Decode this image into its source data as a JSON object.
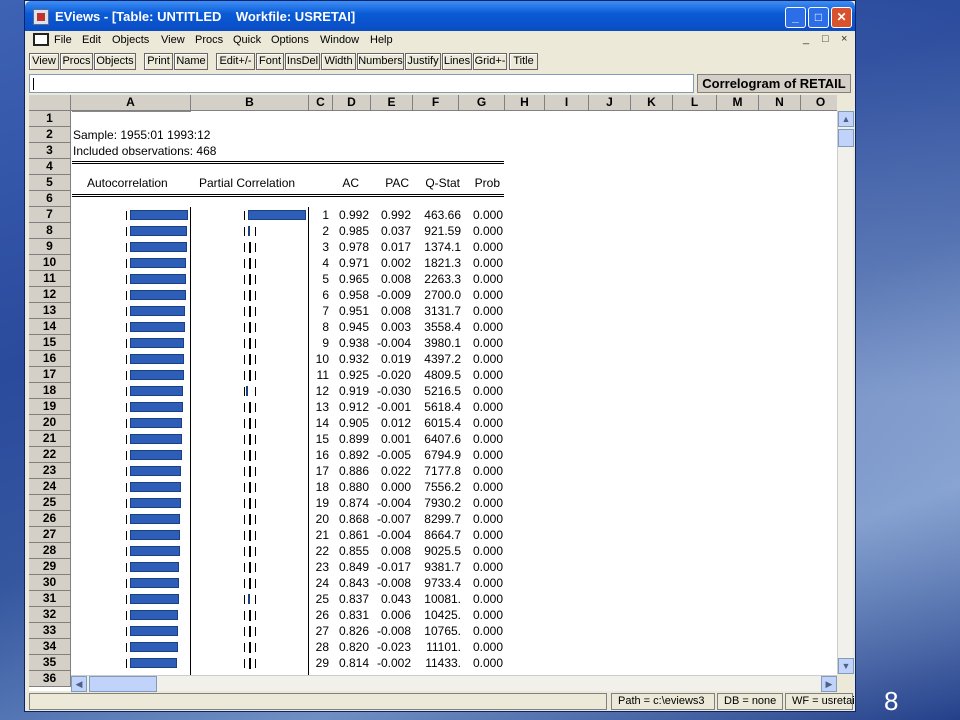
{
  "window": {
    "title": "EViews - [Table: UNTITLED    Workfile: USRETAI]"
  },
  "title_buttons": [
    "_",
    "□",
    "✕"
  ],
  "menu": [
    "File",
    "Edit",
    "Objects",
    "View",
    "Procs",
    "Quick",
    "Options",
    "Window",
    "Help"
  ],
  "mdi_controls": [
    "_",
    "□",
    "×"
  ],
  "toolbar": [
    "View",
    "Procs",
    "Objects",
    "Print",
    "Name",
    "Edit+/-",
    "Font",
    "InsDel",
    "Width",
    "Numbers",
    "Justify",
    "Lines",
    "Grid+-",
    "Title"
  ],
  "edit_field": {
    "value": ""
  },
  "table_title": "Correlogram of RETAIL",
  "columns": [
    "A",
    "B",
    "C",
    "D",
    "E",
    "F",
    "G",
    "H",
    "I",
    "J",
    "K",
    "L",
    "M",
    "N",
    "O"
  ],
  "row_numbers": [
    "1",
    "2",
    "3",
    "4",
    "5",
    "6",
    "7",
    "8",
    "9",
    "10",
    "11",
    "12",
    "13",
    "14",
    "15",
    "16",
    "17",
    "18",
    "19",
    "20",
    "21",
    "22",
    "23",
    "24",
    "25",
    "26",
    "27",
    "28",
    "29",
    "30",
    "31",
    "32",
    "33",
    "34",
    "35",
    "36"
  ],
  "header": {
    "sample": "Sample: 1955:01 1993:12",
    "included": "Included observations: 468"
  },
  "table_headers": {
    "autocorr": "Autocorrelation",
    "partial": "Partial Correlation",
    "ac": "AC",
    "pac": "PAC",
    "qstat": "Q-Stat",
    "prob": "Prob"
  },
  "chart_data": {
    "type": "table",
    "columns": [
      "lag",
      "AC",
      "PAC",
      "Q-Stat",
      "Prob"
    ],
    "rows": [
      [
        "1",
        "0.992",
        "0.992",
        "463.66",
        "0.000"
      ],
      [
        "2",
        "0.985",
        "0.037",
        "921.59",
        "0.000"
      ],
      [
        "3",
        "0.978",
        "0.017",
        "1374.1",
        "0.000"
      ],
      [
        "4",
        "0.971",
        "0.002",
        "1821.3",
        "0.000"
      ],
      [
        "5",
        "0.965",
        "0.008",
        "2263.3",
        "0.000"
      ],
      [
        "6",
        "0.958",
        "-0.009",
        "2700.0",
        "0.000"
      ],
      [
        "7",
        "0.951",
        "0.008",
        "3131.7",
        "0.000"
      ],
      [
        "8",
        "0.945",
        "0.003",
        "3558.4",
        "0.000"
      ],
      [
        "9",
        "0.938",
        "-0.004",
        "3980.1",
        "0.000"
      ],
      [
        "10",
        "0.932",
        "0.019",
        "4397.2",
        "0.000"
      ],
      [
        "11",
        "0.925",
        "-0.020",
        "4809.5",
        "0.000"
      ],
      [
        "12",
        "0.919",
        "-0.030",
        "5216.5",
        "0.000"
      ],
      [
        "13",
        "0.912",
        "-0.001",
        "5618.4",
        "0.000"
      ],
      [
        "14",
        "0.905",
        "0.012",
        "6015.4",
        "0.000"
      ],
      [
        "15",
        "0.899",
        "0.001",
        "6407.6",
        "0.000"
      ],
      [
        "16",
        "0.892",
        "-0.005",
        "6794.9",
        "0.000"
      ],
      [
        "17",
        "0.886",
        "0.022",
        "7177.8",
        "0.000"
      ],
      [
        "18",
        "0.880",
        "0.000",
        "7556.2",
        "0.000"
      ],
      [
        "19",
        "0.874",
        "-0.004",
        "7930.2",
        "0.000"
      ],
      [
        "20",
        "0.868",
        "-0.007",
        "8299.7",
        "0.000"
      ],
      [
        "21",
        "0.861",
        "-0.004",
        "8664.7",
        "0.000"
      ],
      [
        "22",
        "0.855",
        "0.008",
        "9025.5",
        "0.000"
      ],
      [
        "23",
        "0.849",
        "-0.017",
        "9381.7",
        "0.000"
      ],
      [
        "24",
        "0.843",
        "-0.008",
        "9733.4",
        "0.000"
      ],
      [
        "25",
        "0.837",
        "0.043",
        "10081.",
        "0.000"
      ],
      [
        "26",
        "0.831",
        "0.006",
        "10425.",
        "0.000"
      ],
      [
        "27",
        "0.826",
        "-0.008",
        "10765.",
        "0.000"
      ],
      [
        "28",
        "0.820",
        "-0.023",
        "11101.",
        "0.000"
      ],
      [
        "29",
        "0.814",
        "-0.002",
        "11433.",
        "0.000"
      ]
    ]
  },
  "status": {
    "path": "Path = c:\\eviews3",
    "db": "DB = none",
    "wf": "WF = usretai"
  },
  "slide_number": "8",
  "colors": {
    "bar": "#2e5fb8",
    "titlebar": "#0a5ad6"
  }
}
